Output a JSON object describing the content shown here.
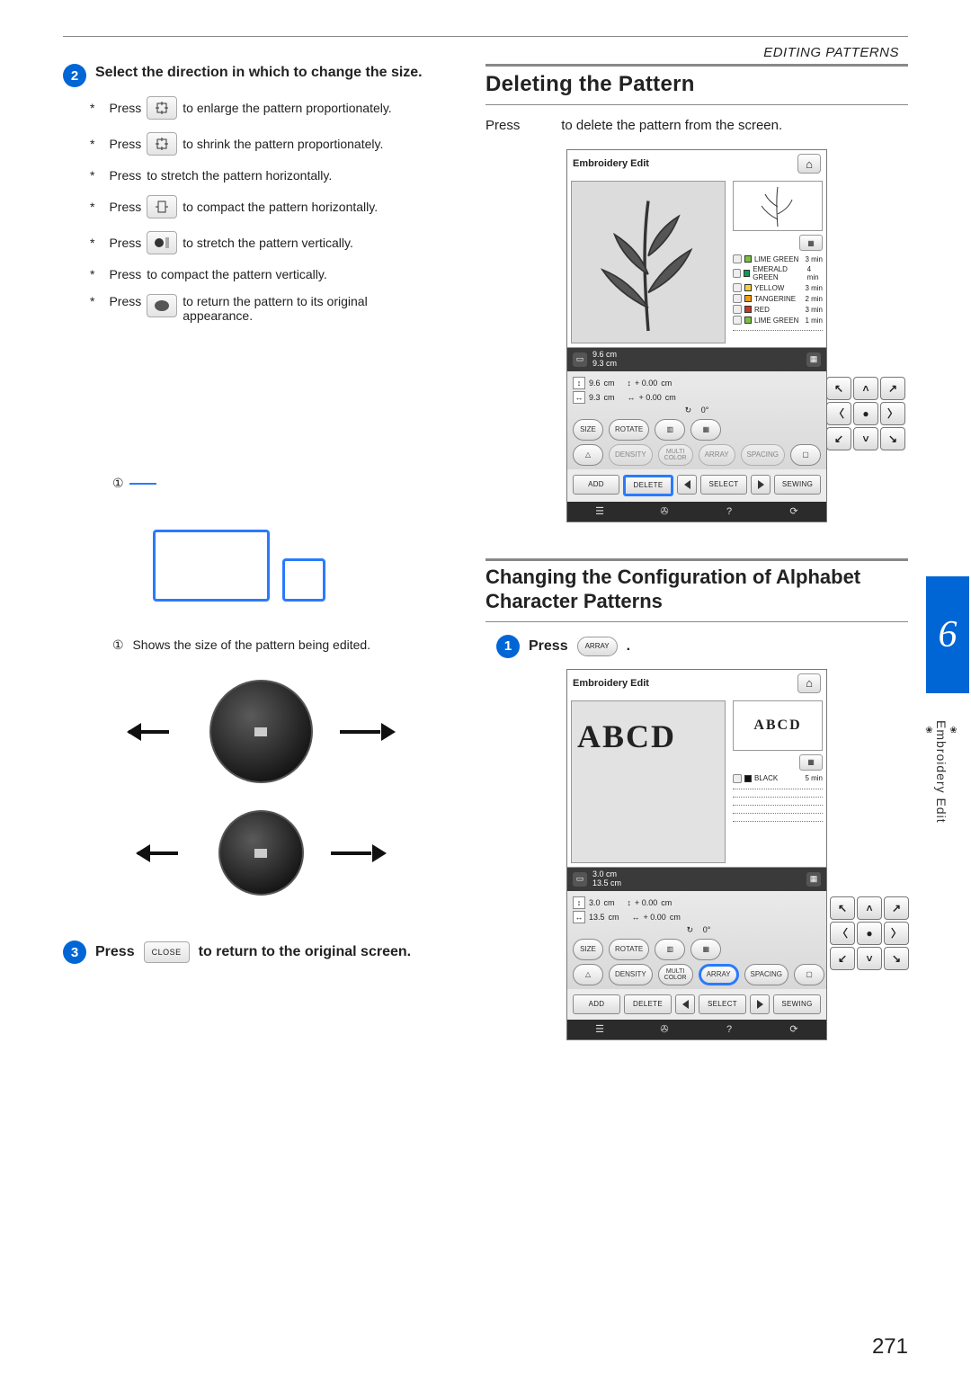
{
  "header": {
    "section": "EDITING PATTERNS"
  },
  "page_number": "271",
  "chapter_tab": "6",
  "side_label": "Embroidery Edit",
  "left": {
    "step2": {
      "num": "2",
      "title": "Select the direction in which to change the size."
    },
    "press_items": [
      {
        "after": "to enlarge the pattern proportionately."
      },
      {
        "after": "to shrink the pattern proportionately."
      },
      {
        "after": "to stretch the pattern horizontally."
      },
      {
        "after": "to compact the pattern horizontally."
      },
      {
        "after": "to stretch the pattern vertically."
      },
      {
        "after": "to compact the pattern vertically."
      },
      {
        "after": "to return the pattern to its original appearance."
      }
    ],
    "press_word": "Press",
    "callout_num": "①",
    "callout_desc": "Shows the size of the pattern being edited.",
    "step3": {
      "num": "3",
      "before": "Press",
      "key": "CLOSE",
      "after": "to return to the original screen."
    }
  },
  "right": {
    "h_delete": "Deleting the Pattern",
    "delete_intro_before": "Press",
    "delete_intro_after": "to delete the pattern from the screen.",
    "h_config": "Changing the Configuration of Alphabet Character Patterns",
    "step1": {
      "num": "1",
      "before": "Press",
      "key": "ARRAY",
      "after": "."
    }
  },
  "screen1": {
    "title": "Embroidery Edit",
    "dims": {
      "h": "9.6",
      "w": "9.3",
      "unit": "cm"
    },
    "info": {
      "h": "9.6",
      "w": "9.3",
      "dy": "+  0.00",
      "dx": "+  0.00",
      "deg": "0°",
      "unit": "cm"
    },
    "colors": [
      {
        "name": "LIME GREEN",
        "time": "3  min",
        "hex": "#7bc043"
      },
      {
        "name": "EMERALD GREEN",
        "time": "4  min",
        "hex": "#119955"
      },
      {
        "name": "YELLOW",
        "time": "3  min",
        "hex": "#f4d03f"
      },
      {
        "name": "TANGERINE",
        "time": "2  min",
        "hex": "#f39c12"
      },
      {
        "name": "RED",
        "time": "3  min",
        "hex": "#c0392b"
      },
      {
        "name": "LIME GREEN",
        "time": "1  min",
        "hex": "#7bc043"
      }
    ],
    "pills": {
      "size": "SIZE",
      "rotate": "ROTATE",
      "density": "DENSITY",
      "multi": "MULTI\nCOLOR",
      "array": "ARRAY",
      "spacing": "SPACING"
    },
    "bottom": {
      "add": "ADD",
      "delete": "DELETE",
      "select": "SELECT",
      "sewing": "SEWING"
    }
  },
  "screen2": {
    "title": "Embroidery Edit",
    "text_preview": "ABCD",
    "dims": {
      "h": "3.0",
      "w": "13.5",
      "unit": "cm"
    },
    "info": {
      "h": "3.0",
      "w": "13.5",
      "dy": "+  0.00",
      "dx": "+  0.00",
      "deg": "0°",
      "unit": "cm"
    },
    "colors": [
      {
        "name": "BLACK",
        "time": "5  min",
        "hex": "#111"
      }
    ],
    "pills": {
      "size": "SIZE",
      "rotate": "ROTATE",
      "density": "DENSITY",
      "multi": "MULTI\nCOLOR",
      "array": "ARRAY",
      "spacing": "SPACING"
    },
    "bottom": {
      "add": "ADD",
      "delete": "DELETE",
      "select": "SELECT",
      "sewing": "SEWING"
    }
  }
}
